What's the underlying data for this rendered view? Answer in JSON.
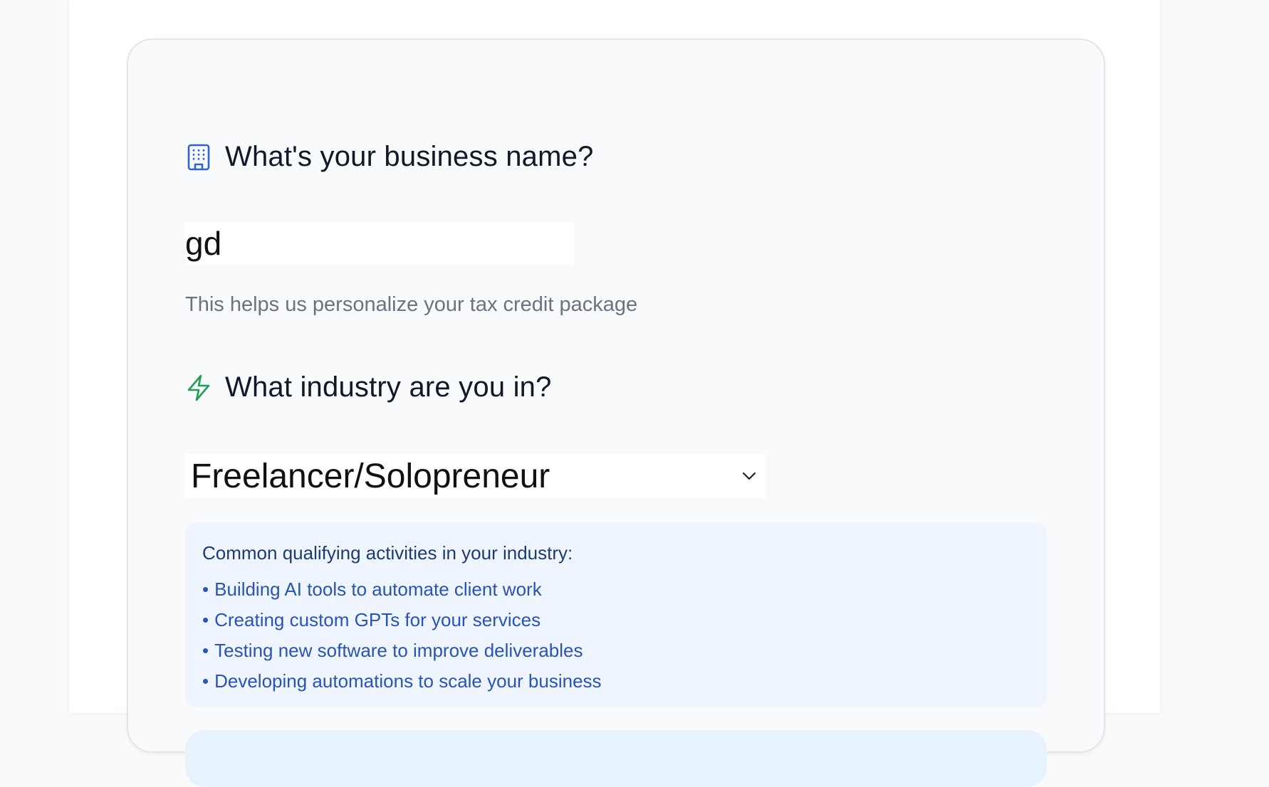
{
  "business": {
    "question": "What's your business name?",
    "icon": "building-icon",
    "icon_color": "#2f63d6",
    "value": "gd",
    "helper": "This helps us personalize your tax credit package"
  },
  "industry": {
    "question": "What industry are you in?",
    "icon": "lightning-icon",
    "icon_color": "#1f9e55",
    "selected": "Freelancer/Solopreneur"
  },
  "activities": {
    "title": "Common qualifying activities in your industry:",
    "bullet": "•",
    "items": [
      "Building AI tools to automate client work",
      "Creating custom GPTs for your services",
      "Testing new software to improve deliverables",
      "Developing automations to scale your business"
    ]
  }
}
